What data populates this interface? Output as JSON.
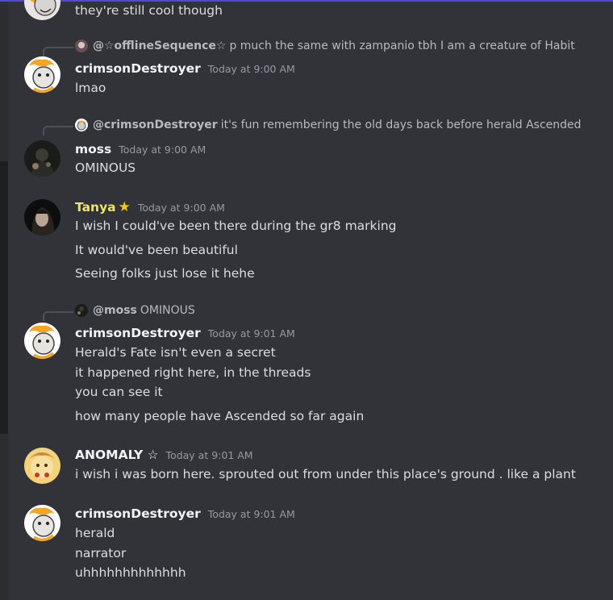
{
  "colors": {
    "background": "#313338",
    "accent": "#4e4cc9",
    "username_default": "#f2f3f5",
    "username_tanya": "#f0e36a",
    "timestamp": "#949ba4"
  },
  "messages": [
    {
      "lines": [
        "they're still cool though"
      ]
    },
    {
      "reply": {
        "author": "@☆offlineSequence☆",
        "text": "p much the same with zampanio tbh I am a creature of Habit"
      },
      "username": "crimsonDestroyer",
      "timestamp": "Today at 9:00 AM",
      "lines": [
        "lmao"
      ]
    },
    {
      "reply": {
        "author": "@crimsonDestroyer",
        "text": "it's fun remembering the old days back before herald Ascended"
      },
      "username": "moss",
      "timestamp": "Today at 9:00 AM",
      "lines": [
        "OMINOUS"
      ]
    },
    {
      "username": "Tanya",
      "timestamp": "Today at 9:00 AM",
      "lines": [
        "I wish I could've been there during the gr8 marking",
        "It would've been beautiful",
        "Seeing folks just lose it hehe"
      ]
    },
    {
      "reply": {
        "author": "@moss",
        "text": "OMINOUS"
      },
      "username": "crimsonDestroyer",
      "timestamp": "Today at 9:01 AM",
      "lines": [
        "Herald's Fate isn't even a secret",
        "it happened right here, in the threads",
        "you can see it",
        "how many people have Ascended so far again"
      ]
    },
    {
      "username": "ANOMALY ☆",
      "timestamp": "Today at 9:01 AM",
      "lines": [
        "i wish i was born here. sprouted out from under this place's ground . like a plant"
      ]
    },
    {
      "username": "crimsonDestroyer",
      "timestamp": "Today at 9:01 AM",
      "lines": [
        "herald",
        "narrator",
        "uhhhhhhhhhhhhh"
      ]
    }
  ]
}
